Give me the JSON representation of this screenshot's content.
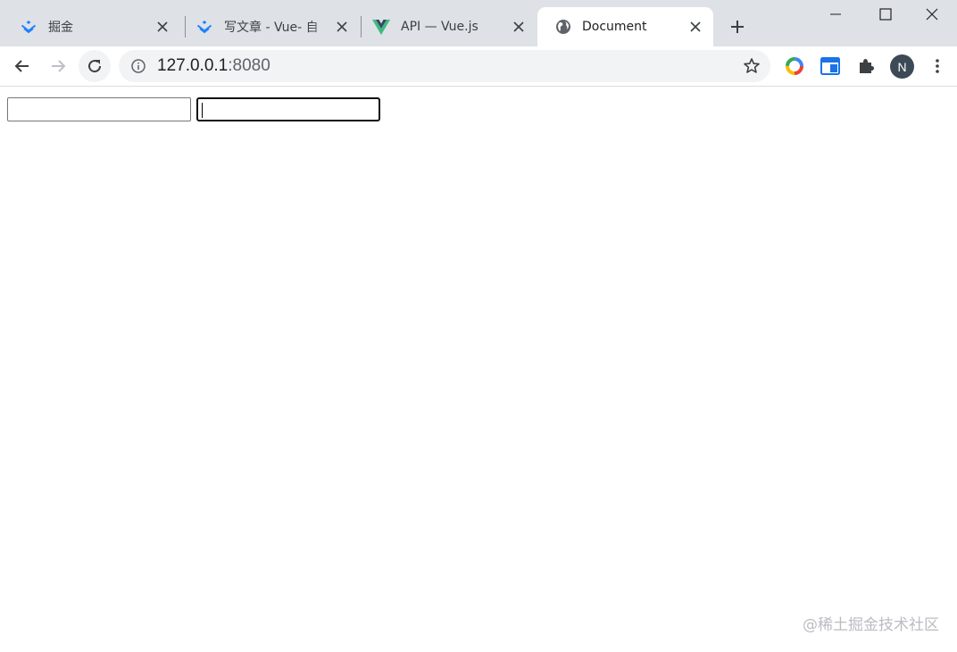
{
  "browser": {
    "tabs": [
      {
        "title": "掘金",
        "favicon": "juejin-icon",
        "active": false
      },
      {
        "title": "写文章 - Vue- 自",
        "favicon": "juejin-icon",
        "active": false
      },
      {
        "title": "API — Vue.js",
        "favicon": "vue-icon",
        "active": false
      },
      {
        "title": "Document",
        "favicon": "globe-icon",
        "active": true
      }
    ],
    "address": {
      "host": "127.0.0.1",
      "port": ":8080"
    },
    "profile_initial": "N"
  },
  "page": {
    "input_1_value": "",
    "input_2_value": ""
  },
  "watermark": "@稀土掘金技术社区",
  "colors": {
    "titlebar": "#dee1e6",
    "omnibox": "#f1f3f4",
    "juejin_blue": "#1e80ff",
    "vue_green": "#41b883",
    "vue_dark": "#34495e"
  }
}
